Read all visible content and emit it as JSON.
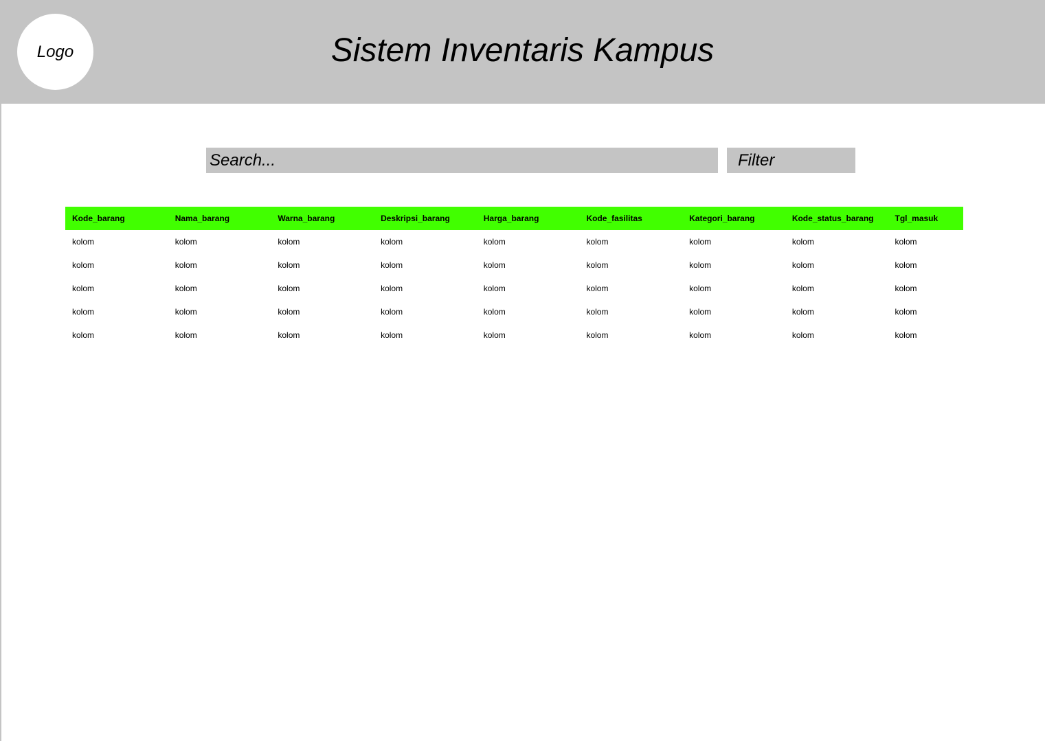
{
  "header": {
    "logo_label": "Logo",
    "title": "Sistem Inventaris Kampus",
    "background": "#c4c4c4"
  },
  "search": {
    "placeholder": "Search...",
    "value": ""
  },
  "filter": {
    "label": "Filter"
  },
  "table": {
    "header_color": "#41ff00",
    "columns": [
      "Kode_barang",
      "Nama_barang",
      "Warna_barang",
      "Deskripsi_barang",
      "Harga_barang",
      "Kode_fasilitas",
      "Kategori_barang",
      "Kode_status_barang",
      "Tgl_masuk"
    ],
    "rows": [
      [
        "kolom",
        "kolom",
        "kolom",
        "kolom",
        "kolom",
        "kolom",
        "kolom",
        "kolom",
        "kolom"
      ],
      [
        "kolom",
        "kolom",
        "kolom",
        "kolom",
        "kolom",
        "kolom",
        "kolom",
        "kolom",
        "kolom"
      ],
      [
        "kolom",
        "kolom",
        "kolom",
        "kolom",
        "kolom",
        "kolom",
        "kolom",
        "kolom",
        "kolom"
      ],
      [
        "kolom",
        "kolom",
        "kolom",
        "kolom",
        "kolom",
        "kolom",
        "kolom",
        "kolom",
        "kolom"
      ],
      [
        "kolom",
        "kolom",
        "kolom",
        "kolom",
        "kolom",
        "kolom",
        "kolom",
        "kolom",
        "kolom"
      ]
    ]
  }
}
